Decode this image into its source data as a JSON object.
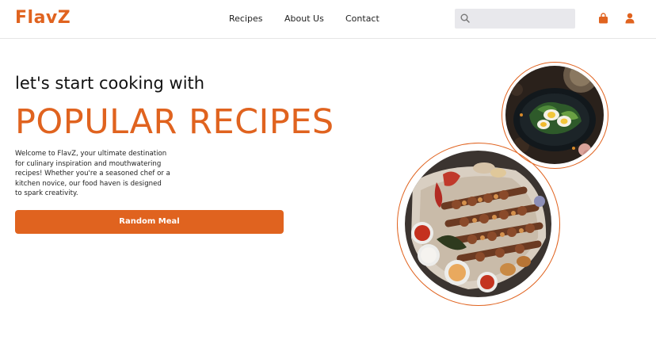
{
  "brand": {
    "name": "FlavZ"
  },
  "nav": {
    "recipes": "Recipes",
    "about": "About Us",
    "contact": "Contact"
  },
  "search": {
    "placeholder": "",
    "value": ""
  },
  "icons": {
    "search": "search-icon",
    "bag": "shopping-bag-icon",
    "user": "user-icon"
  },
  "hero": {
    "pre_title": "let's start cooking with",
    "title": "POPULAR RECIPES",
    "description": "Welcome to FlavZ, your ultimate destination for culinary inspiration and mouthwatering recipes! Whether you're a seasoned chef or a kitchen novice, our food haven is designed to spark creativity.",
    "button_label": "Random Meal"
  },
  "images": {
    "small": "egg-salad-plate-photo",
    "large": "grilled-kebab-platter-photo"
  },
  "colors": {
    "accent": "#e0631f",
    "search_bg": "#e8e8ec",
    "text": "#222222"
  }
}
